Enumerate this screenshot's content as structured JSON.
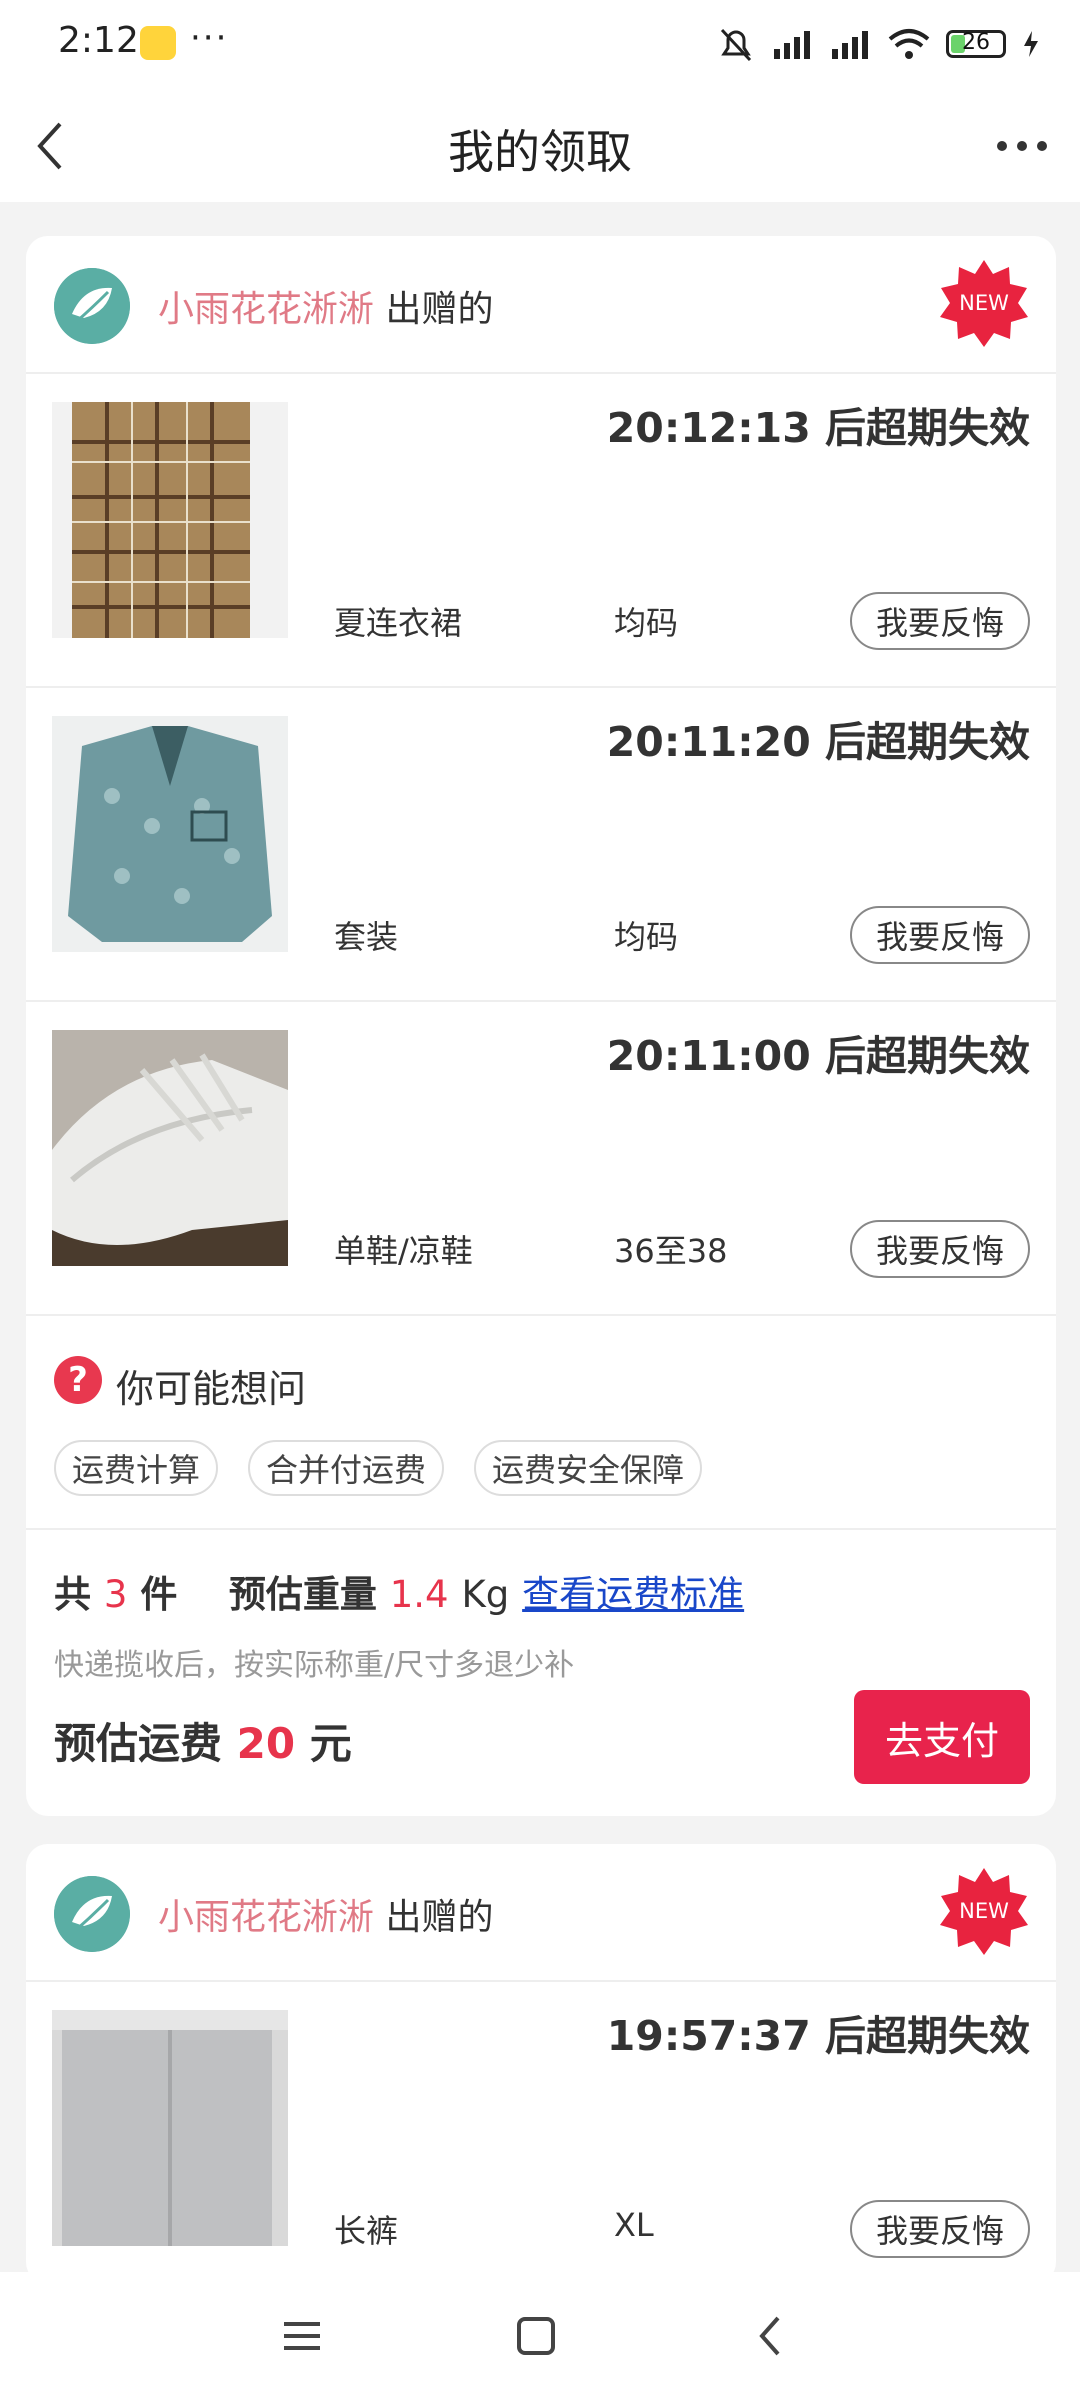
{
  "status": {
    "time": "2:12",
    "dots": "···",
    "battery": "26"
  },
  "header": {
    "title": "我的领取"
  },
  "cards": [
    {
      "giver_name": "小雨花花淅淅",
      "giver_suffix": "出赠的",
      "badge": "NEW",
      "items": [
        {
          "countdown": "20:12:13 后超期失效",
          "name": "夏连衣裙",
          "size": "均码",
          "action": "我要反悔"
        },
        {
          "countdown": "20:11:20 后超期失效",
          "name": "套装",
          "size": "均码",
          "action": "我要反悔"
        },
        {
          "countdown": "20:11:00 后超期失效",
          "name": "单鞋/凉鞋",
          "size": "36至38",
          "action": "我要反悔"
        }
      ],
      "faq": {
        "icon": "?",
        "title": "你可能想问",
        "chips": [
          "运费计算",
          "合并付运费",
          "运费安全保障"
        ]
      },
      "summary": {
        "count_prefix": "共",
        "count": "3",
        "count_suffix": "件",
        "weight_label": "预估重量",
        "weight": "1.4",
        "weight_unit": "Kg",
        "link": "查看运费标准",
        "note": "快递揽收后，按实际称重/尺寸多退少补",
        "fee_label": "预估运费",
        "fee": "20",
        "fee_unit": "元",
        "pay": "去支付"
      }
    },
    {
      "giver_name": "小雨花花淅淅",
      "giver_suffix": "出赠的",
      "badge": "NEW",
      "items": [
        {
          "countdown": "19:57:37 后超期失效",
          "name": "长裤",
          "size": "XL",
          "action": "我要反悔"
        }
      ]
    }
  ]
}
